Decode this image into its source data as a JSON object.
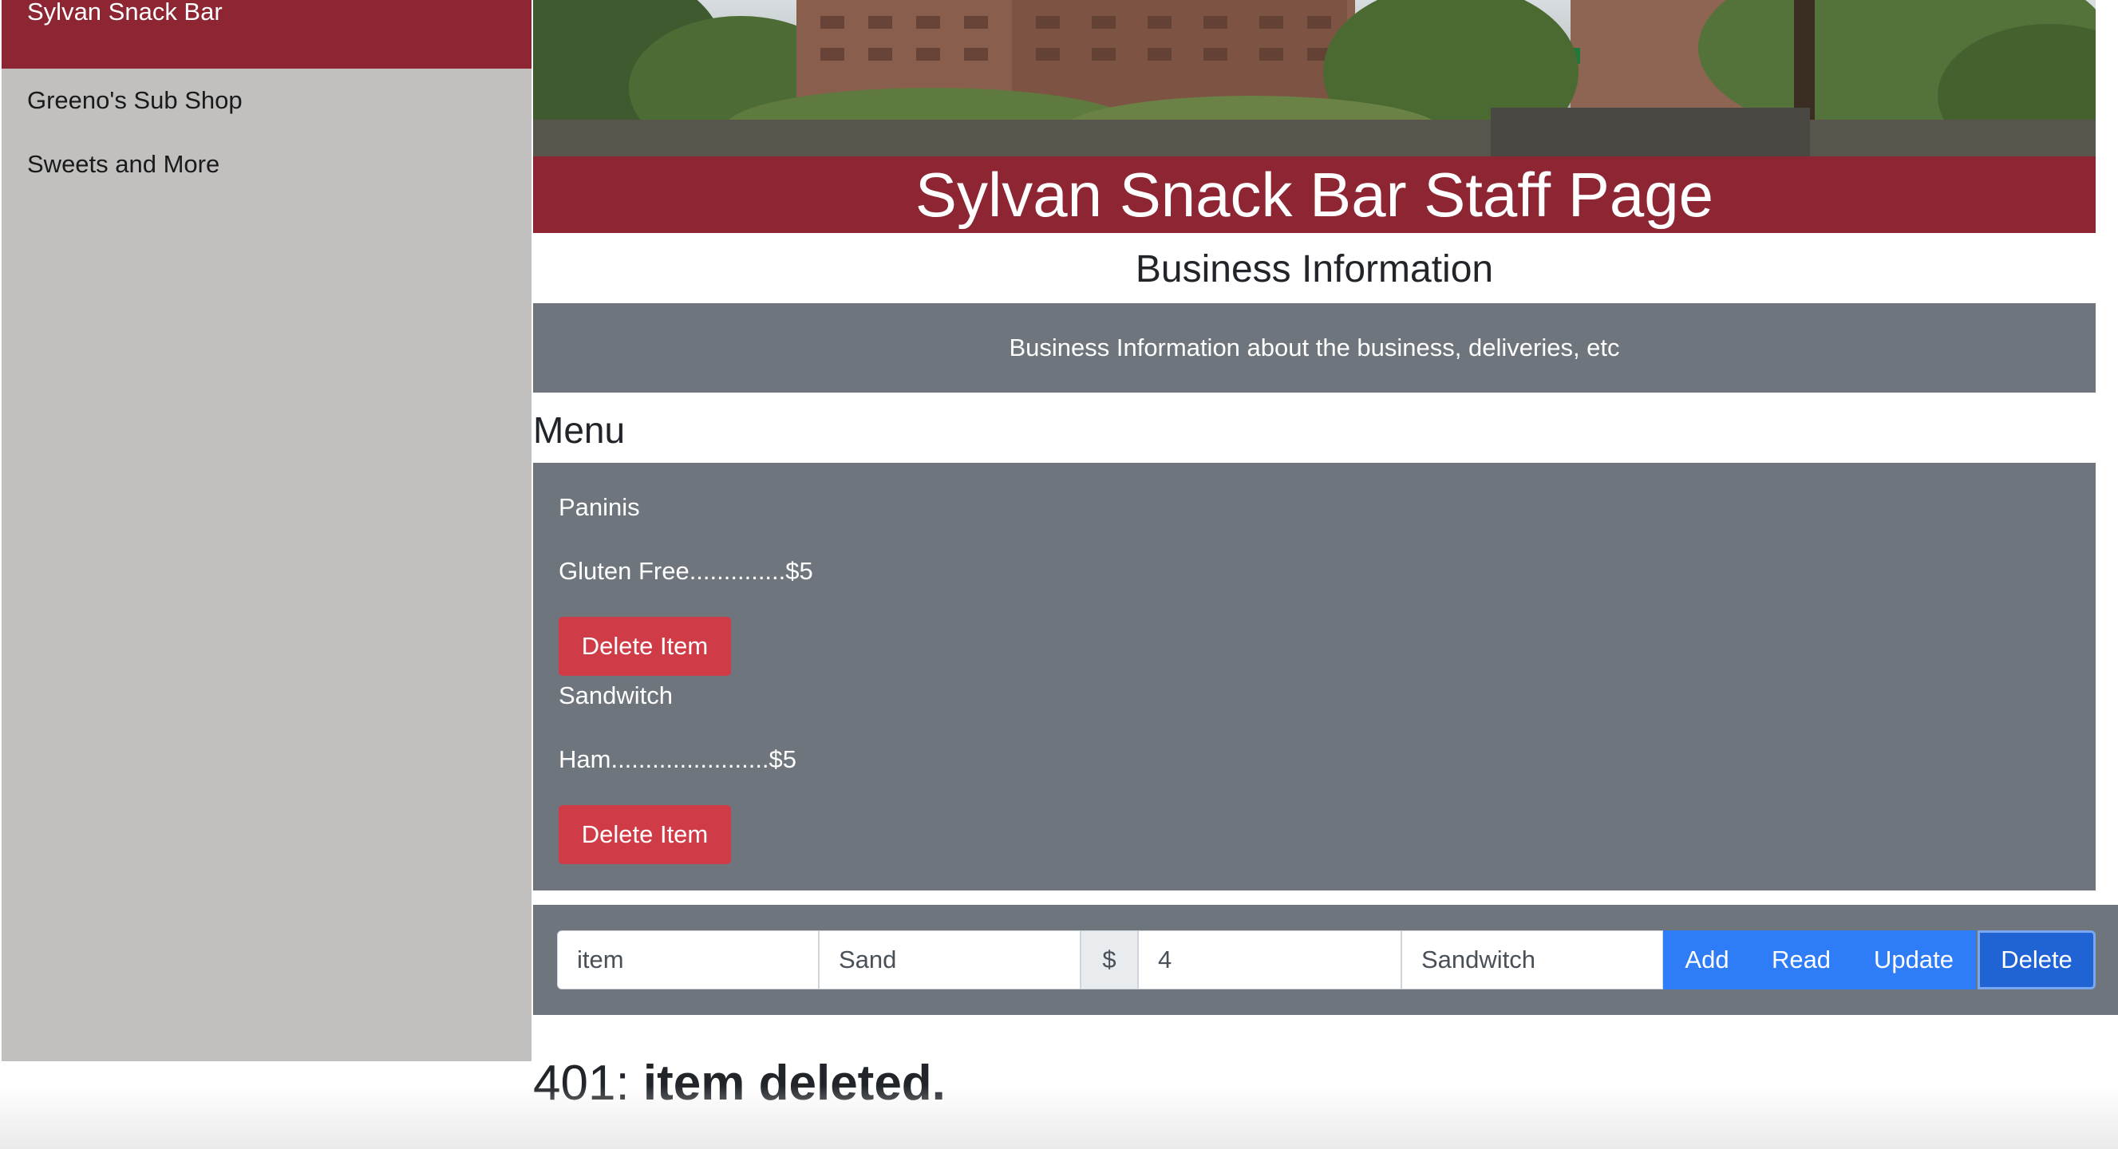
{
  "sidebar": {
    "active": "Sylvan Snack Bar",
    "items": [
      {
        "label": "Greeno's Sub Shop"
      },
      {
        "label": "Sweets and More"
      }
    ]
  },
  "header": {
    "title": "Sylvan Snack Bar Staff Page"
  },
  "business": {
    "heading": "Business Information",
    "text": "Business Information about the business, deliveries, etc"
  },
  "menu": {
    "heading": "Menu",
    "sections": [
      {
        "category": "Paninis",
        "item": "Gluten Free..............$5",
        "delete_label": "Delete Item"
      },
      {
        "category": "Sandwitch",
        "item": "Ham.......................$5",
        "delete_label": "Delete Item"
      }
    ]
  },
  "form": {
    "item_value": "item",
    "name_value": "Sand",
    "currency_symbol": "$",
    "price_value": "4",
    "category_value": "Sandwitch",
    "buttons": {
      "add": "Add",
      "read": "Read",
      "update": "Update",
      "delete": "Delete"
    }
  },
  "status": {
    "code": "401:",
    "message": "item deleted."
  },
  "colors": {
    "brand": "#8d2532",
    "panel": "#6f757c",
    "sidebar": "#c1c0bf",
    "danger": "#cf3c47",
    "primary": "#2e7cf6"
  }
}
